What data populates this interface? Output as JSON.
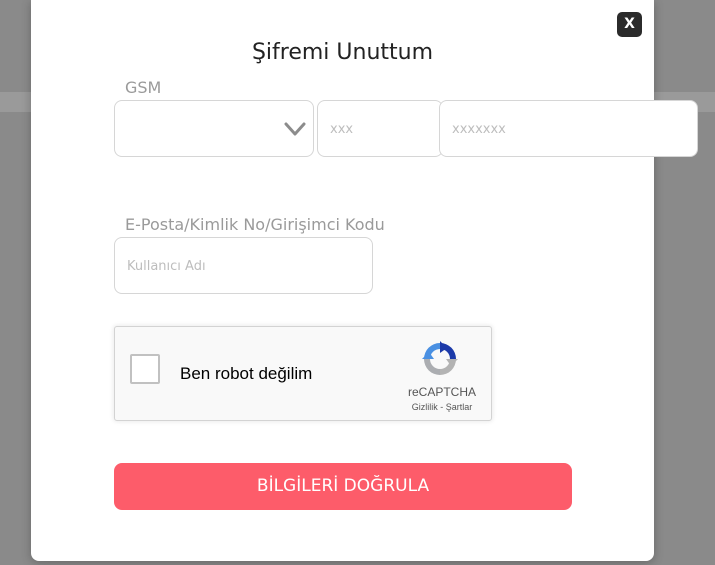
{
  "modal": {
    "close_label": "X",
    "title": "Şifremi Unuttum"
  },
  "gsm": {
    "label": "GSM",
    "country_select_value": "",
    "area_placeholder": "xxx",
    "number_placeholder": "xxxxxxx"
  },
  "identity": {
    "label": "E-Posta/Kimlik No/Girişimci Kodu",
    "username_placeholder": "Kullanıcı Adı"
  },
  "recaptcha": {
    "checkbox_label": "Ben robot değilim",
    "brand": "reCAPTCHA",
    "privacy_link": "Gizlilik",
    "separator": "-",
    "terms_link": "Şartlar",
    "logo_icon": "recaptcha-logo-icon"
  },
  "submit": {
    "label": "BİLGİLERİ DOĞRULA"
  },
  "colors": {
    "accent": "#fd5c6a",
    "close_bg": "#2b2b2b",
    "overlay": "#8a8a8a"
  }
}
